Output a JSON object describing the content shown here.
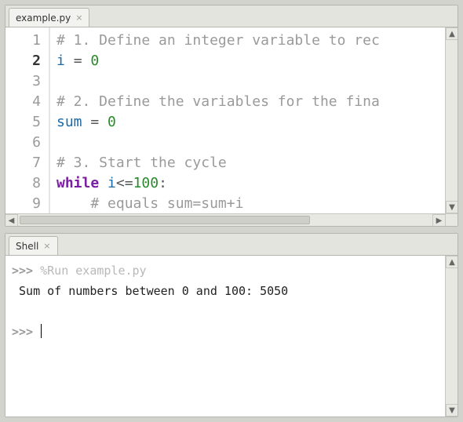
{
  "editor": {
    "tab_label": "example.py",
    "lines": [
      {
        "n": "1",
        "tokens": [
          [
            "comment",
            "# 1. Define an integer variable to rec"
          ]
        ]
      },
      {
        "n": "2",
        "tokens": [
          [
            "name",
            "i"
          ],
          [
            "plain",
            " "
          ],
          [
            "op",
            "="
          ],
          [
            "plain",
            " "
          ],
          [
            "num",
            "0"
          ]
        ],
        "active": true
      },
      {
        "n": "3",
        "tokens": []
      },
      {
        "n": "4",
        "tokens": [
          [
            "comment",
            "# 2. Define the variables for the fina"
          ]
        ]
      },
      {
        "n": "5",
        "tokens": [
          [
            "name",
            "sum"
          ],
          [
            "plain",
            " "
          ],
          [
            "op",
            "="
          ],
          [
            "plain",
            " "
          ],
          [
            "num",
            "0"
          ]
        ]
      },
      {
        "n": "6",
        "tokens": []
      },
      {
        "n": "7",
        "tokens": [
          [
            "comment",
            "# 3. Start the cycle"
          ]
        ]
      },
      {
        "n": "8",
        "tokens": [
          [
            "keyword",
            "while"
          ],
          [
            "plain",
            " "
          ],
          [
            "name",
            "i"
          ],
          [
            "op",
            "<="
          ],
          [
            "num",
            "100"
          ],
          [
            "op",
            ":"
          ]
        ]
      },
      {
        "n": "9",
        "tokens": [
          [
            "plain",
            "    "
          ],
          [
            "comment",
            "# equals sum=sum+i"
          ]
        ]
      }
    ]
  },
  "shell": {
    "tab_label": "Shell",
    "prompt": ">>>",
    "run_cmd": "%Run example.py",
    "output": " Sum of numbers between 0 and 100: 5050"
  }
}
